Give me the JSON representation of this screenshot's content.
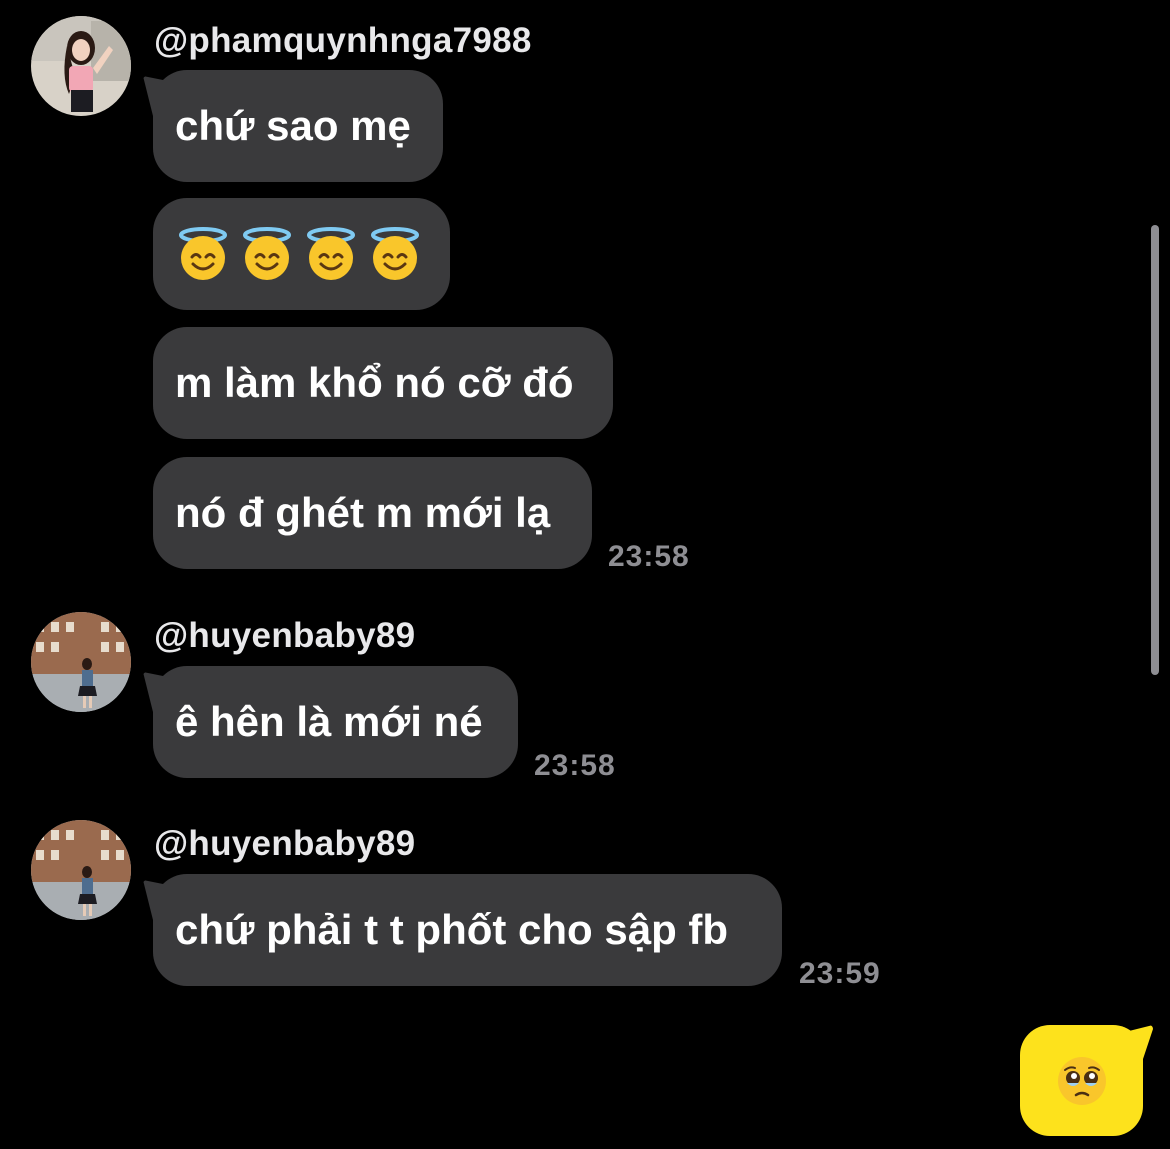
{
  "messages": [
    {
      "sender": "@phamquynhnga7988",
      "bubbles": [
        {
          "text": "chứ sao mẹ"
        },
        {
          "emoji": [
            "smiling-face-with-halo",
            "smiling-face-with-halo",
            "smiling-face-with-halo",
            "smiling-face-with-halo"
          ]
        },
        {
          "text": "m làm khổ nó cỡ đó"
        },
        {
          "text": "nó đ ghét m mới lạ"
        }
      ],
      "time": "23:58"
    },
    {
      "sender": "@huyenbaby89",
      "bubbles": [
        {
          "text": "ê hên là mới né"
        }
      ],
      "time": "23:58"
    },
    {
      "sender": "@huyenbaby89",
      "bubbles": [
        {
          "text": "chứ phải t t phốt cho sập fb"
        }
      ],
      "time": "23:59"
    }
  ],
  "reaction_bubble": {
    "emoji": "pleading-face",
    "color": "#FDE21C"
  },
  "colors": {
    "background": "#000000",
    "bubble": "#3A3A3C",
    "timestamp": "#8E8E93"
  }
}
